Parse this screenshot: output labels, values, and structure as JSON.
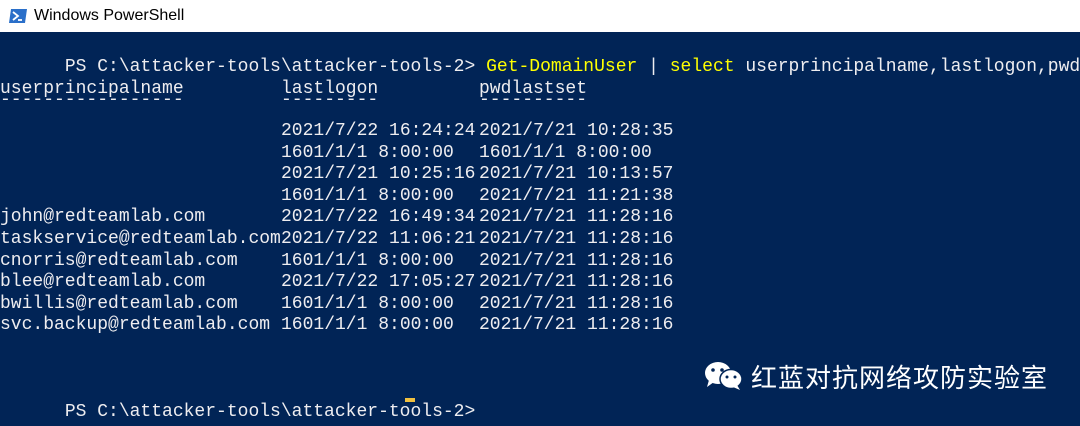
{
  "window": {
    "title": "Windows PowerShell",
    "icon": "powershell-icon"
  },
  "console": {
    "prompt_path": "PS C:\\attacker-tools\\attacker-tools-2> ",
    "command": {
      "cmdlet": "Get-DomainUser",
      "pipe": " | ",
      "select": "select",
      "args": " userprincipalname,lastlogon,pwdlastset"
    },
    "headers": [
      "userprincipalname",
      "lastlogon",
      "pwdlastset"
    ],
    "underlines": [
      "-----------------",
      "---------",
      "----------"
    ],
    "rows": [
      {
        "upn": "",
        "lastlogon": "2021/7/22 16:24:24",
        "pwdlastset": "2021/7/21 10:28:35"
      },
      {
        "upn": "",
        "lastlogon": "1601/1/1 8:00:00",
        "pwdlastset": "1601/1/1 8:00:00"
      },
      {
        "upn": "",
        "lastlogon": "2021/7/21 10:25:16",
        "pwdlastset": "2021/7/21 10:13:57"
      },
      {
        "upn": "",
        "lastlogon": "1601/1/1 8:00:00",
        "pwdlastset": "2021/7/21 11:21:38"
      },
      {
        "upn": "john@redteamlab.com",
        "lastlogon": "2021/7/22 16:49:34",
        "pwdlastset": "2021/7/21 11:28:16"
      },
      {
        "upn": "taskservice@redteamlab.com",
        "lastlogon": "2021/7/22 11:06:21",
        "pwdlastset": "2021/7/21 11:28:16"
      },
      {
        "upn": "cnorris@redteamlab.com",
        "lastlogon": "1601/1/1 8:00:00",
        "pwdlastset": "2021/7/21 11:28:16"
      },
      {
        "upn": "blee@redteamlab.com",
        "lastlogon": "2021/7/22 17:05:27",
        "pwdlastset": "2021/7/21 11:28:16"
      },
      {
        "upn": "bwillis@redteamlab.com",
        "lastlogon": "1601/1/1 8:00:00",
        "pwdlastset": "2021/7/21 11:28:16"
      },
      {
        "upn": "svc.backup@redteamlab.com",
        "lastlogon": "1601/1/1 8:00:00",
        "pwdlastset": "2021/7/21 11:28:16"
      }
    ],
    "final_prompt": "PS C:\\attacker-tools\\attacker-tools-2> "
  },
  "watermark": {
    "text": "红蓝对抗网络攻防实验室",
    "icon": "wechat-icon"
  },
  "colors": {
    "background": "#012456",
    "text": "#eeedf0",
    "command": "#ffff00",
    "cursor": "#f0c040"
  }
}
